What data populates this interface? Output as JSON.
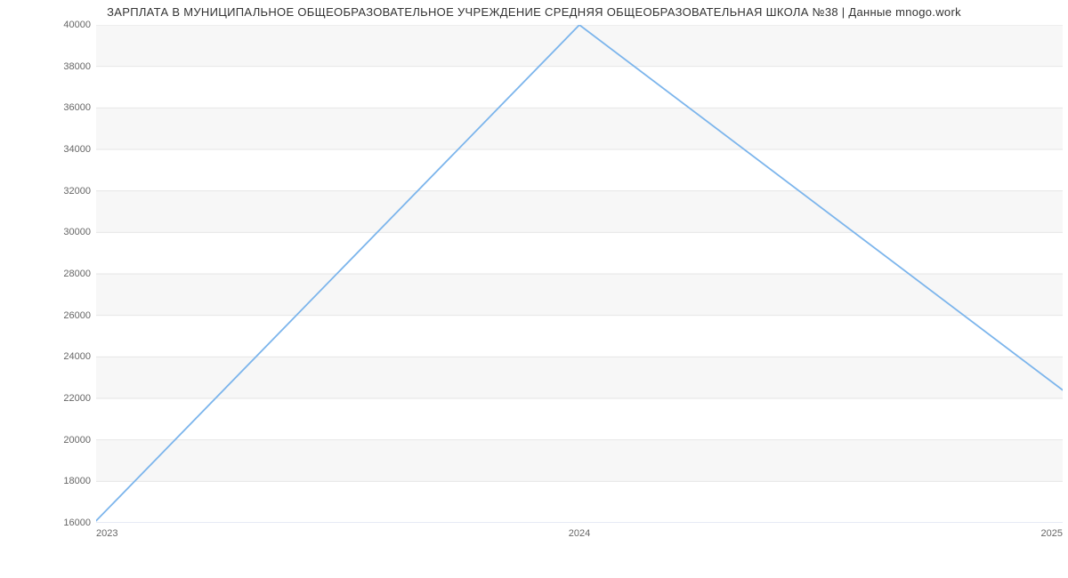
{
  "chart_data": {
    "type": "line",
    "title": "ЗАРПЛАТА В МУНИЦИПАЛЬНОЕ ОБЩЕОБРАЗОВАТЕЛЬНОЕ УЧРЕЖДЕНИЕ СРЕДНЯЯ ОБЩЕОБРАЗОВАТЕЛЬНАЯ   ШКОЛА №38 | Данные mnogo.work",
    "x": [
      "2023",
      "2024",
      "2025"
    ],
    "values": [
      16100,
      40000,
      22400
    ],
    "y_ticks": [
      16000,
      18000,
      20000,
      22000,
      24000,
      26000,
      28000,
      30000,
      32000,
      34000,
      36000,
      38000,
      40000
    ],
    "x_ticks": [
      "2023",
      "2024",
      "2025"
    ],
    "ylim": [
      16000,
      40000
    ],
    "line_color": "#7cb5ec",
    "grid_color": "#e6e6e6",
    "band_color": "#f7f7f7"
  }
}
